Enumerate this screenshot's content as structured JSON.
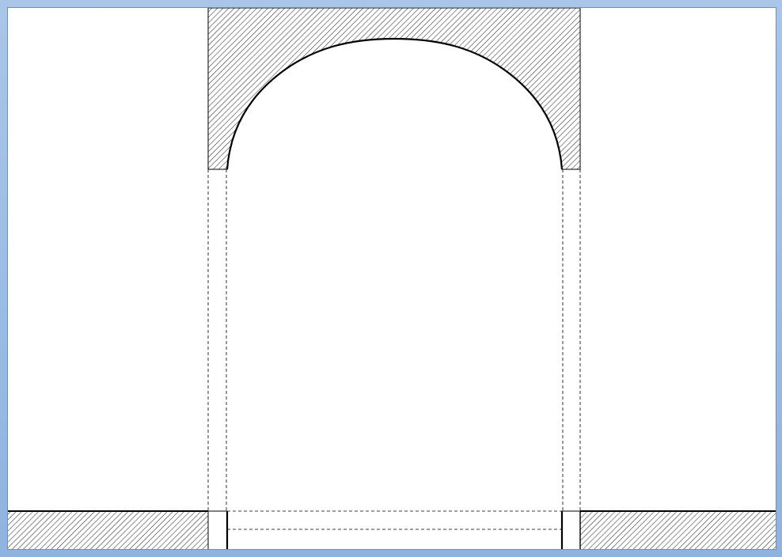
{
  "diagram": {
    "type": "arch-section-drawing",
    "elements": [
      "arch-lintel-hatched",
      "left-wall-hatched",
      "right-wall-hatched",
      "left-jamb",
      "right-jamb",
      "threshold",
      "hidden-lines"
    ]
  },
  "colors": {
    "line": "#000000",
    "hatch": "#000000",
    "background": "#ffffff",
    "frame": "#8fb3df"
  }
}
